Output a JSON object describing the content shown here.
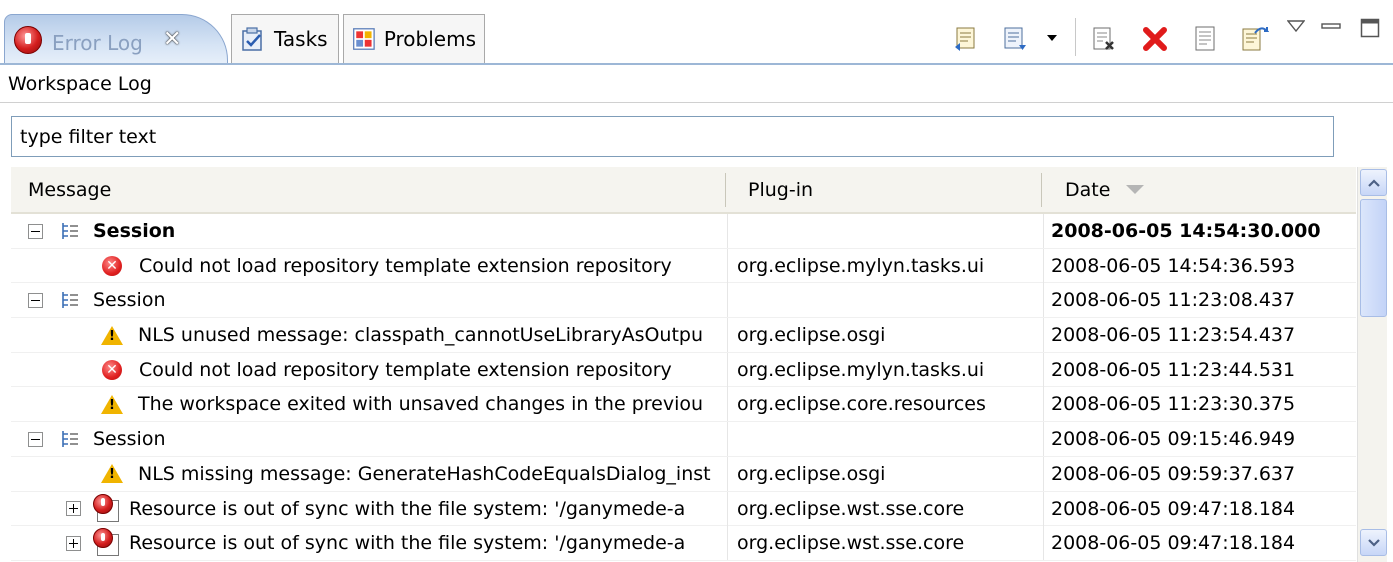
{
  "tabs": [
    {
      "label": "Error Log",
      "active": true
    },
    {
      "label": "Tasks",
      "active": false
    },
    {
      "label": "Problems",
      "active": false
    }
  ],
  "toolbar_icons": [
    "export-log-icon",
    "import-log-icon",
    "dropdown-arrow-icon",
    "clear-log-viewer-icon",
    "delete-log-icon",
    "open-log-icon",
    "restore-log-icon",
    "view-menu-icon",
    "minimize-icon",
    "maximize-icon"
  ],
  "log_label": "Workspace Log",
  "filter": {
    "value": "type filter text"
  },
  "columns": {
    "message": "Message",
    "plugin": "Plug-in",
    "date": "Date"
  },
  "rows": [
    {
      "type": "session",
      "bold": true,
      "message": "Session",
      "plugin": "",
      "date": "2008-06-05 14:54:30.000"
    },
    {
      "type": "error",
      "message": "Could not load repository template extension repository",
      "plugin": "org.eclipse.mylyn.tasks.ui",
      "date": "2008-06-05 14:54:36.593"
    },
    {
      "type": "session",
      "message": "Session",
      "plugin": "",
      "date": "2008-06-05 11:23:08.437"
    },
    {
      "type": "warning",
      "message": "NLS unused message: classpath_cannotUseLibraryAsOutpu",
      "plugin": "org.eclipse.osgi",
      "date": "2008-06-05 11:23:54.437"
    },
    {
      "type": "error",
      "message": "Could not load repository template extension repository",
      "plugin": "org.eclipse.mylyn.tasks.ui",
      "date": "2008-06-05 11:23:44.531"
    },
    {
      "type": "warning",
      "message": "The workspace exited with unsaved changes in the previou",
      "plugin": "org.eclipse.core.resources",
      "date": "2008-06-05 11:23:30.375"
    },
    {
      "type": "session",
      "message": "Session",
      "plugin": "",
      "date": "2008-06-05 09:15:46.949"
    },
    {
      "type": "warning",
      "message": "NLS missing message: GenerateHashCodeEqualsDialog_inst",
      "plugin": "org.eclipse.osgi",
      "date": "2008-06-05 09:59:37.637"
    },
    {
      "type": "error-group",
      "message": "Resource is out of sync with the file system: '/ganymede-a",
      "plugin": "org.eclipse.wst.sse.core",
      "date": "2008-06-05 09:47:18.184"
    },
    {
      "type": "error-group",
      "message": "Resource is out of sync with the file system: '/ganymede-a",
      "plugin": "org.eclipse.wst.sse.core",
      "date": "2008-06-05 09:47:18.184"
    }
  ]
}
